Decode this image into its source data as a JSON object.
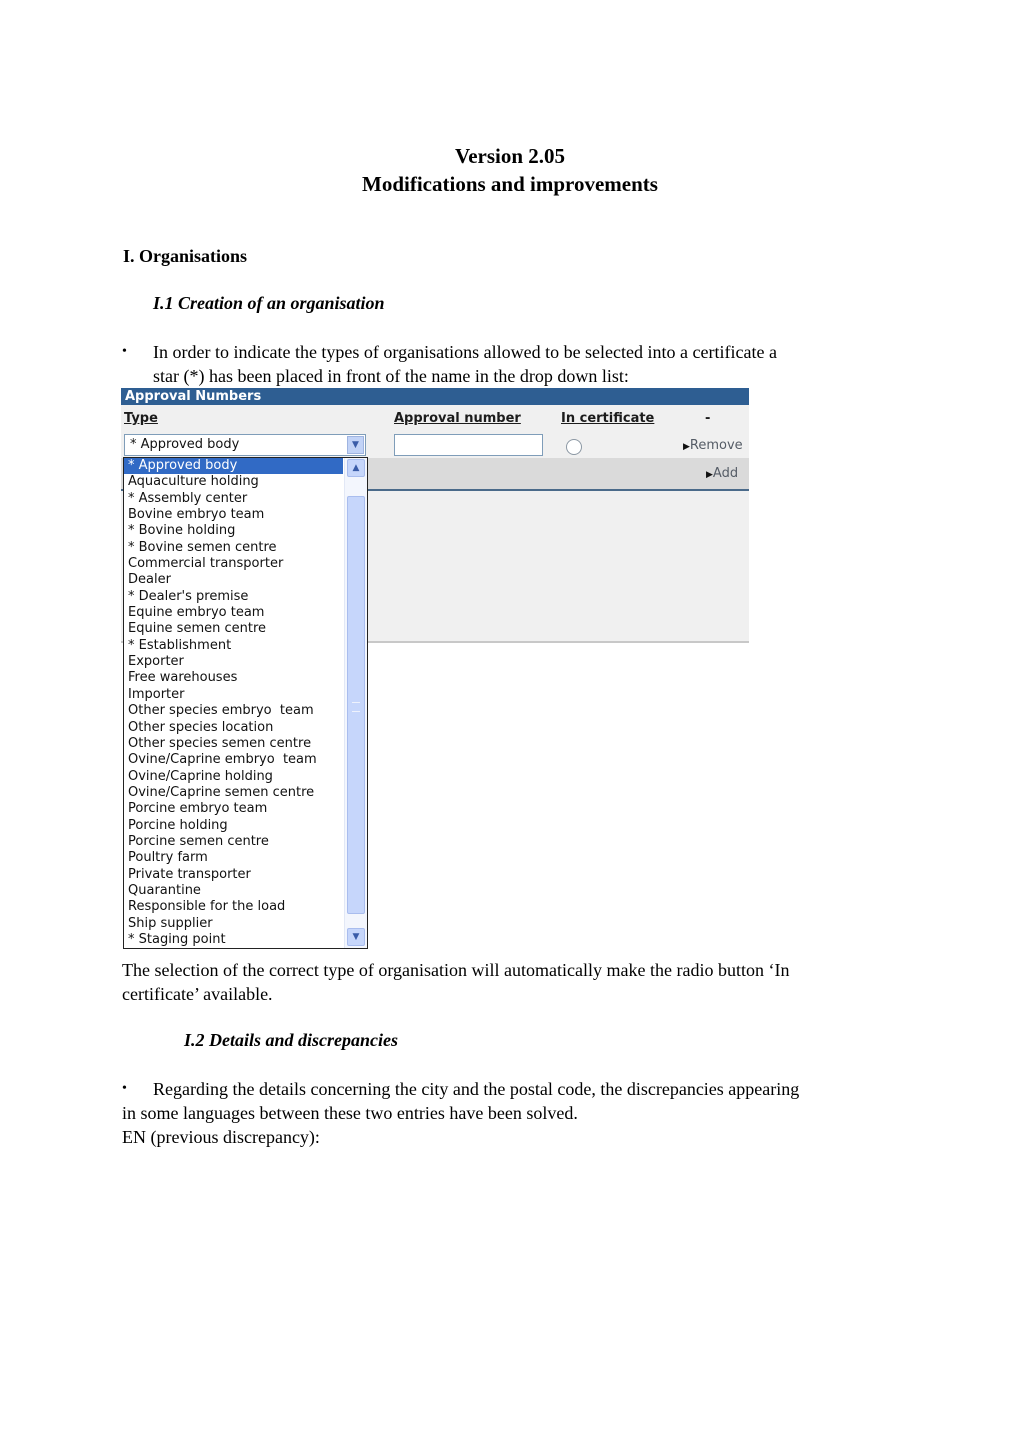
{
  "document": {
    "title_line1": "Version 2.05",
    "title_line2": "Modifications and improvements",
    "section1_heading": "I. Organisations",
    "subsection1_heading": "I.1 Creation of an organisation",
    "bullet_glyph": "•",
    "bullet1_line1": "In order to indicate the types of organisations allowed to be selected into a certificate a",
    "bullet1_line2": "star (*) has been placed in front of the name in the drop down list:",
    "after_screenshot_line1": "The selection of the correct type of organisation will automatically make the radio button ‘In",
    "after_screenshot_line2": "certificate’ available.",
    "subsection2_heading": "I.2 Details and discrepancies",
    "bullet2_line1": "Regarding the details concerning the city and the postal code, the discrepancies appearing",
    "bullet2_line2": "in some languages between these two entries have been solved.",
    "en_label": "EN (previous discrepancy):"
  },
  "screenshot": {
    "panel_title": "Approval Numbers",
    "columns": {
      "type": "Type",
      "approval_number": "Approval number",
      "in_certificate": "In certificate",
      "extra": "-"
    },
    "type_select_value": "* Approved body",
    "approval_number_value": "",
    "in_certificate_checked": false,
    "remove_label": "Remove",
    "add_label": "Add",
    "link_arrow": "▶",
    "select_arrow": "▼",
    "scroll_up": "▲",
    "scroll_down": "▼",
    "dropdown_selected_index": 0,
    "dropdown_options": [
      "* Approved body",
      "Aquaculture holding",
      "* Assembly center",
      "Bovine embryo team",
      "* Bovine holding",
      "* Bovine semen centre",
      "Commercial transporter",
      "Dealer",
      "* Dealer's premise",
      "Equine embryo team",
      "Equine semen centre",
      "* Establishment",
      "Exporter",
      "Free warehouses",
      "Importer",
      "Other species embryo  team",
      "Other species location",
      "Other species semen centre",
      "Ovine/Caprine embryo  team",
      "Ovine/Caprine holding",
      "Ovine/Caprine semen centre",
      "Porcine embryo team",
      "Porcine holding",
      "Porcine semen centre",
      "Poultry farm",
      "Private transporter",
      "Quarantine",
      "Responsible for the load",
      "Ship supplier",
      "* Staging point"
    ]
  }
}
